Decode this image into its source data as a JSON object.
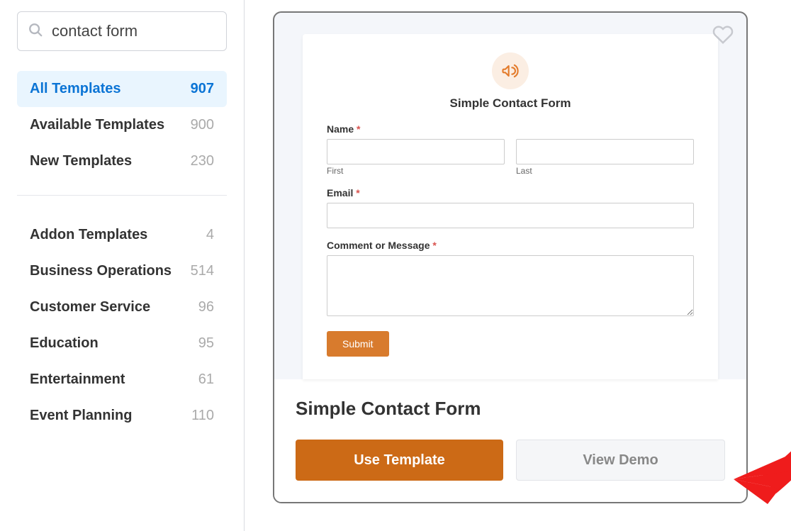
{
  "search": {
    "value": "contact form"
  },
  "primary_categories": [
    {
      "label": "All Templates",
      "count": "907",
      "active": true
    },
    {
      "label": "Available Templates",
      "count": "900",
      "active": false
    },
    {
      "label": "New Templates",
      "count": "230",
      "active": false
    }
  ],
  "secondary_categories": [
    {
      "label": "Addon Templates",
      "count": "4"
    },
    {
      "label": "Business Operations",
      "count": "514"
    },
    {
      "label": "Customer Service",
      "count": "96"
    },
    {
      "label": "Education",
      "count": "95"
    },
    {
      "label": "Entertainment",
      "count": "61"
    },
    {
      "label": "Event Planning",
      "count": "110"
    }
  ],
  "preview": {
    "form_title": "Simple Contact Form",
    "name_label": "Name",
    "first_sub": "First",
    "last_sub": "Last",
    "email_label": "Email",
    "comment_label": "Comment or Message",
    "required_mark": "*",
    "submit": "Submit"
  },
  "card": {
    "title": "Simple Contact Form",
    "use_template": "Use Template",
    "view_demo": "View Demo"
  }
}
